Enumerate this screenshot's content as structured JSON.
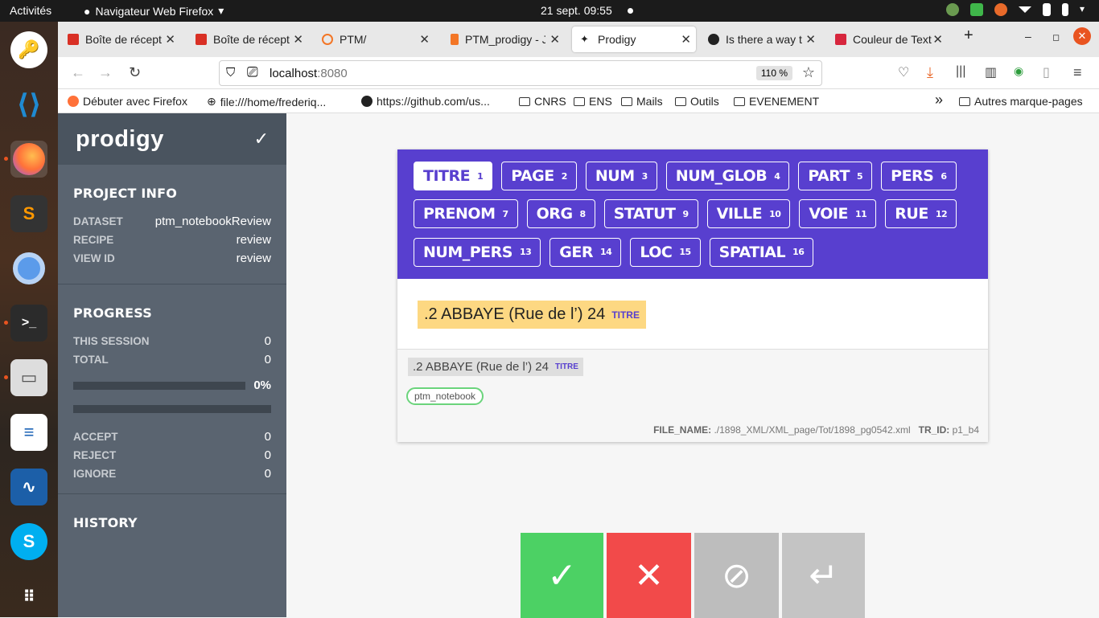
{
  "os": {
    "activities": "Activités",
    "app_name": "Navigateur Web Firefox",
    "clock": "21 sept.  09:55"
  },
  "browser": {
    "tabs": [
      {
        "label": "Boîte de récept",
        "color": "#d93025"
      },
      {
        "label": "Boîte de récept",
        "color": "#d93025"
      },
      {
        "label": "PTM/",
        "color": "#f37626"
      },
      {
        "label": "PTM_prodigy - J",
        "color": "#f37626"
      },
      {
        "label": "Prodigy",
        "color": "#222222"
      },
      {
        "label": "Is there a way t",
        "color": "#222222"
      },
      {
        "label": "Couleur de Text",
        "color": "#d7263d"
      }
    ],
    "url_host": "localhost",
    "url_port": ":8080",
    "zoom": "110 %",
    "bookmarks": [
      "Débuter avec Firefox",
      "file:///home/frederiq...",
      "https://github.com/us...",
      "CNRS",
      "ENS",
      "Mails",
      "Outils",
      "EVENEMENT"
    ],
    "other_bookmarks": "Autres marque-pages"
  },
  "sidebar": {
    "logo": "prodigy",
    "project_info_title": "PROJECT INFO",
    "dataset_key": "DATASET",
    "dataset_val": "ptm_notebookReview",
    "recipe_key": "RECIPE",
    "recipe_val": "review",
    "viewid_key": "VIEW ID",
    "viewid_val": "review",
    "progress_title": "PROGRESS",
    "session_key": "THIS SESSION",
    "session_val": "0",
    "total_key": "TOTAL",
    "total_val": "0",
    "progress_pct": "0%",
    "progress_fraction": 0,
    "accept_key": "ACCEPT",
    "accept_val": "0",
    "reject_key": "REJECT",
    "reject_val": "0",
    "ignore_key": "IGNORE",
    "ignore_val": "0",
    "history_title": "HISTORY"
  },
  "labels": [
    {
      "name": "TITRE",
      "key": "1"
    },
    {
      "name": "PAGE",
      "key": "2"
    },
    {
      "name": "NUM",
      "key": "3"
    },
    {
      "name": "NUM_GLOB",
      "key": "4"
    },
    {
      "name": "PART",
      "key": "5"
    },
    {
      "name": "PERS",
      "key": "6"
    },
    {
      "name": "PRENOM",
      "key": "7"
    },
    {
      "name": "ORG",
      "key": "8"
    },
    {
      "name": "STATUT",
      "key": "9"
    },
    {
      "name": "VILLE",
      "key": "10"
    },
    {
      "name": "VOIE",
      "key": "11"
    },
    {
      "name": "RUE",
      "key": "12"
    },
    {
      "name": "NUM_PERS",
      "key": "13"
    },
    {
      "name": "GER",
      "key": "14"
    },
    {
      "name": "LOC",
      "key": "15"
    },
    {
      "name": "SPATIAL",
      "key": "16"
    }
  ],
  "task": {
    "entity_text": ".2 ABBAYE (Rue de l’) 24",
    "entity_label": "TITRE",
    "source_tag": "ptm_notebook",
    "file_name_key": "FILE_NAME:",
    "file_name_val": "./1898_XML/XML_page/Tot/1898_pg0542.xml",
    "tr_id_key": "TR_ID:",
    "tr_id_val": "p1_b4"
  },
  "actions": {
    "accept": "✓",
    "reject": "✕",
    "ignore": "⊘",
    "undo": "↵",
    "accept_color": "#4cd164",
    "reject_color": "#f24a4a",
    "ignore_color": "#bdbdbd",
    "undo_color": "#c4c4c4"
  }
}
